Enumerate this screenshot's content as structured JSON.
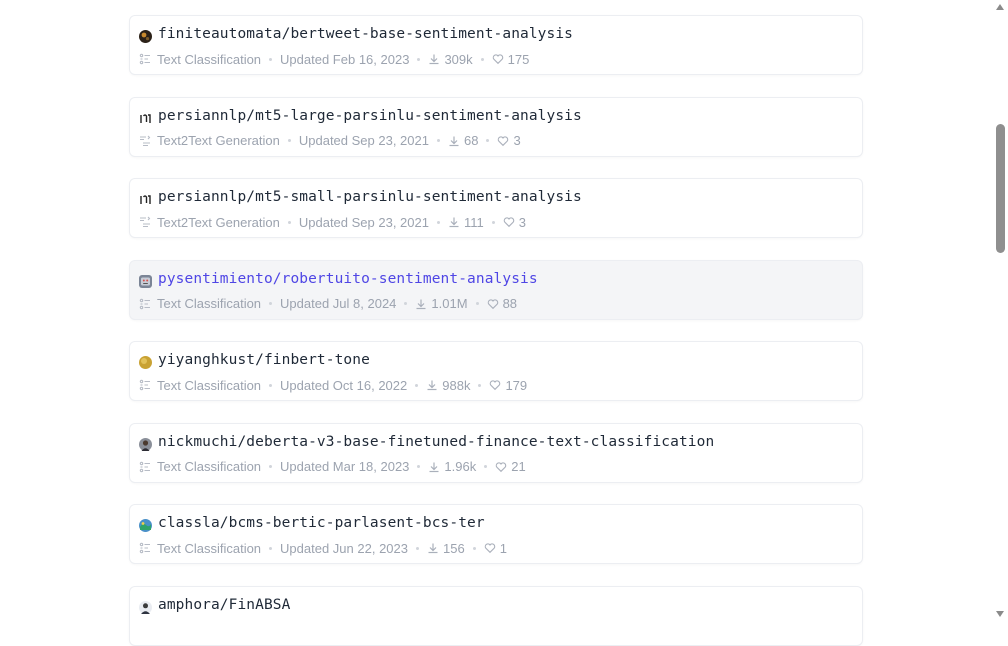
{
  "models": [
    {
      "name": "finiteautomata/bertweet-base-sentiment-analysis",
      "task": "Text Classification",
      "updated": "Updated Feb 16, 2023",
      "downloads": "309k",
      "likes": "175",
      "avatar": "finiteautomata-avatar",
      "task_icon": "text-classification-icon"
    },
    {
      "name": "persiannlp/mt5-large-parsinlu-sentiment-analysis",
      "task": "Text2Text Generation",
      "updated": "Updated Sep 23, 2021",
      "downloads": "68",
      "likes": "3",
      "avatar": "persiannlp-avatar",
      "task_icon": "text2text-generation-icon"
    },
    {
      "name": "persiannlp/mt5-small-parsinlu-sentiment-analysis",
      "task": "Text2Text Generation",
      "updated": "Updated Sep 23, 2021",
      "downloads": "111",
      "likes": "3",
      "avatar": "persiannlp-avatar",
      "task_icon": "text2text-generation-icon"
    },
    {
      "name": "pysentimiento/robertuito-sentiment-analysis",
      "task": "Text Classification",
      "updated": "Updated Jul 8, 2024",
      "downloads": "1.01M",
      "likes": "88",
      "avatar": "pysentimiento-avatar",
      "task_icon": "text-classification-icon",
      "hovered": true
    },
    {
      "name": "yiyanghkust/finbert-tone",
      "task": "Text Classification",
      "updated": "Updated Oct 16, 2022",
      "downloads": "988k",
      "likes": "179",
      "avatar": "yiyanghkust-avatar",
      "task_icon": "text-classification-icon"
    },
    {
      "name": "nickmuchi/deberta-v3-base-finetuned-finance-text-classification",
      "task": "Text Classification",
      "updated": "Updated Mar 18, 2023",
      "downloads": "1.96k",
      "likes": "21",
      "avatar": "nickmuchi-avatar",
      "task_icon": "text-classification-icon"
    },
    {
      "name": "classla/bcms-bertic-parlasent-bcs-ter",
      "task": "Text Classification",
      "updated": "Updated Jun 22, 2023",
      "downloads": "156",
      "likes": "1",
      "avatar": "classla-avatar",
      "task_icon": "text-classification-icon"
    },
    {
      "name": "amphora/FinABSA",
      "task": "",
      "updated": "",
      "downloads": "",
      "likes": "",
      "avatar": "amphora-avatar",
      "task_icon": ""
    }
  ],
  "icons": {
    "download": "download-icon",
    "like": "heart-icon"
  },
  "colors": {
    "hover_link": "#4f46e5",
    "name_text": "#1f2937",
    "meta_text": "#9ca3af"
  }
}
